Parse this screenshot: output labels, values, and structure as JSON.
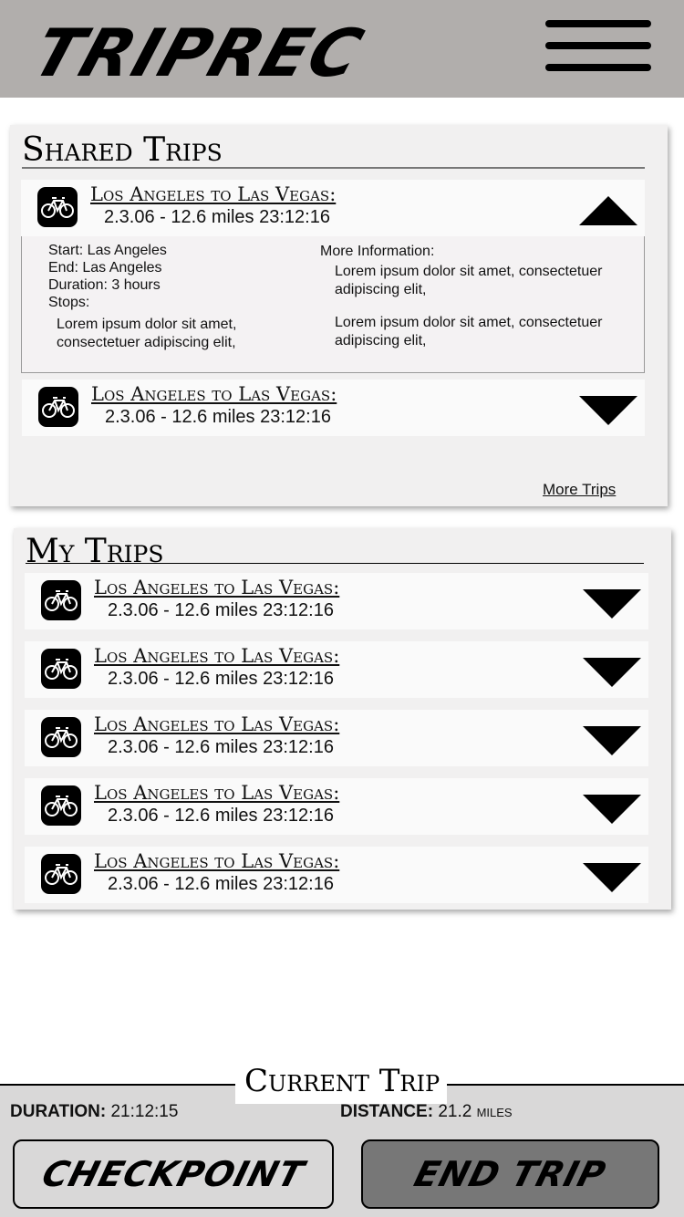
{
  "header": {
    "logo_text": "TRIPREC",
    "menu_icon": "hamburger-menu-icon"
  },
  "shared_trips": {
    "title": "Shared Trips",
    "expanded_trip": {
      "title": "Los Angeles to Las Vegas:",
      "meta": "2.3.06 - 12.6 miles  23:12:16",
      "icon": "bicycle-icon",
      "details": {
        "start": "Start: Las Angeles",
        "end": "End: Las Angeles",
        "duration": "Duration: 3 hours",
        "stops_label": "Stops:",
        "stops_text_1": "Lorem ipsum dolor sit amet,",
        "stops_text_2": "consectetuer adipiscing elit,",
        "more_info_label": "More Information:",
        "info_1_line_1": "Lorem ipsum dolor sit amet, consectetuer",
        "info_1_line_2": "adipiscing elit,",
        "info_2_line_1": "Lorem ipsum dolor sit amet, consectetuer",
        "info_2_line_2": "adipiscing elit,"
      }
    },
    "collapsed_trip": {
      "title": "Los Angeles to Las Vegas:",
      "meta": "2.3.06 - 12.6 miles  23:12:16",
      "icon": "bicycle-icon"
    },
    "more_trips_label": "More Trips"
  },
  "my_trips": {
    "title": "My Trips",
    "trips": [
      {
        "title": "Los Angeles to Las Vegas:",
        "meta": "2.3.06 - 12.6 miles  23:12:16",
        "icon": "bicycle-icon"
      },
      {
        "title": "Los Angeles to Las Vegas:",
        "meta": "2.3.06 - 12.6 miles  23:12:16",
        "icon": "bicycle-icon"
      },
      {
        "title": "Los Angeles to Las Vegas:",
        "meta": "2.3.06 - 12.6 miles  23:12:16",
        "icon": "bicycle-icon"
      },
      {
        "title": "Los Angeles to Las Vegas:",
        "meta": "2.3.06 - 12.6 miles  23:12:16",
        "icon": "bicycle-icon"
      },
      {
        "title": "Los Angeles to Las Vegas:",
        "meta": "2.3.06 - 12.6 miles  23:12:16",
        "icon": "bicycle-icon"
      }
    ]
  },
  "current_trip": {
    "title": "Current Trip",
    "duration_label": "DURATION:",
    "duration_value": "21:12:15",
    "distance_label": "DISTANCE:",
    "distance_value": "21.2 miles",
    "checkpoint_label": "CHECKPOINT",
    "end_trip_label": "END TRIP"
  },
  "colors": {
    "header_bg": "#b1aeac",
    "panel_bg": "#f1f0f0",
    "end_button_bg": "#777777"
  }
}
